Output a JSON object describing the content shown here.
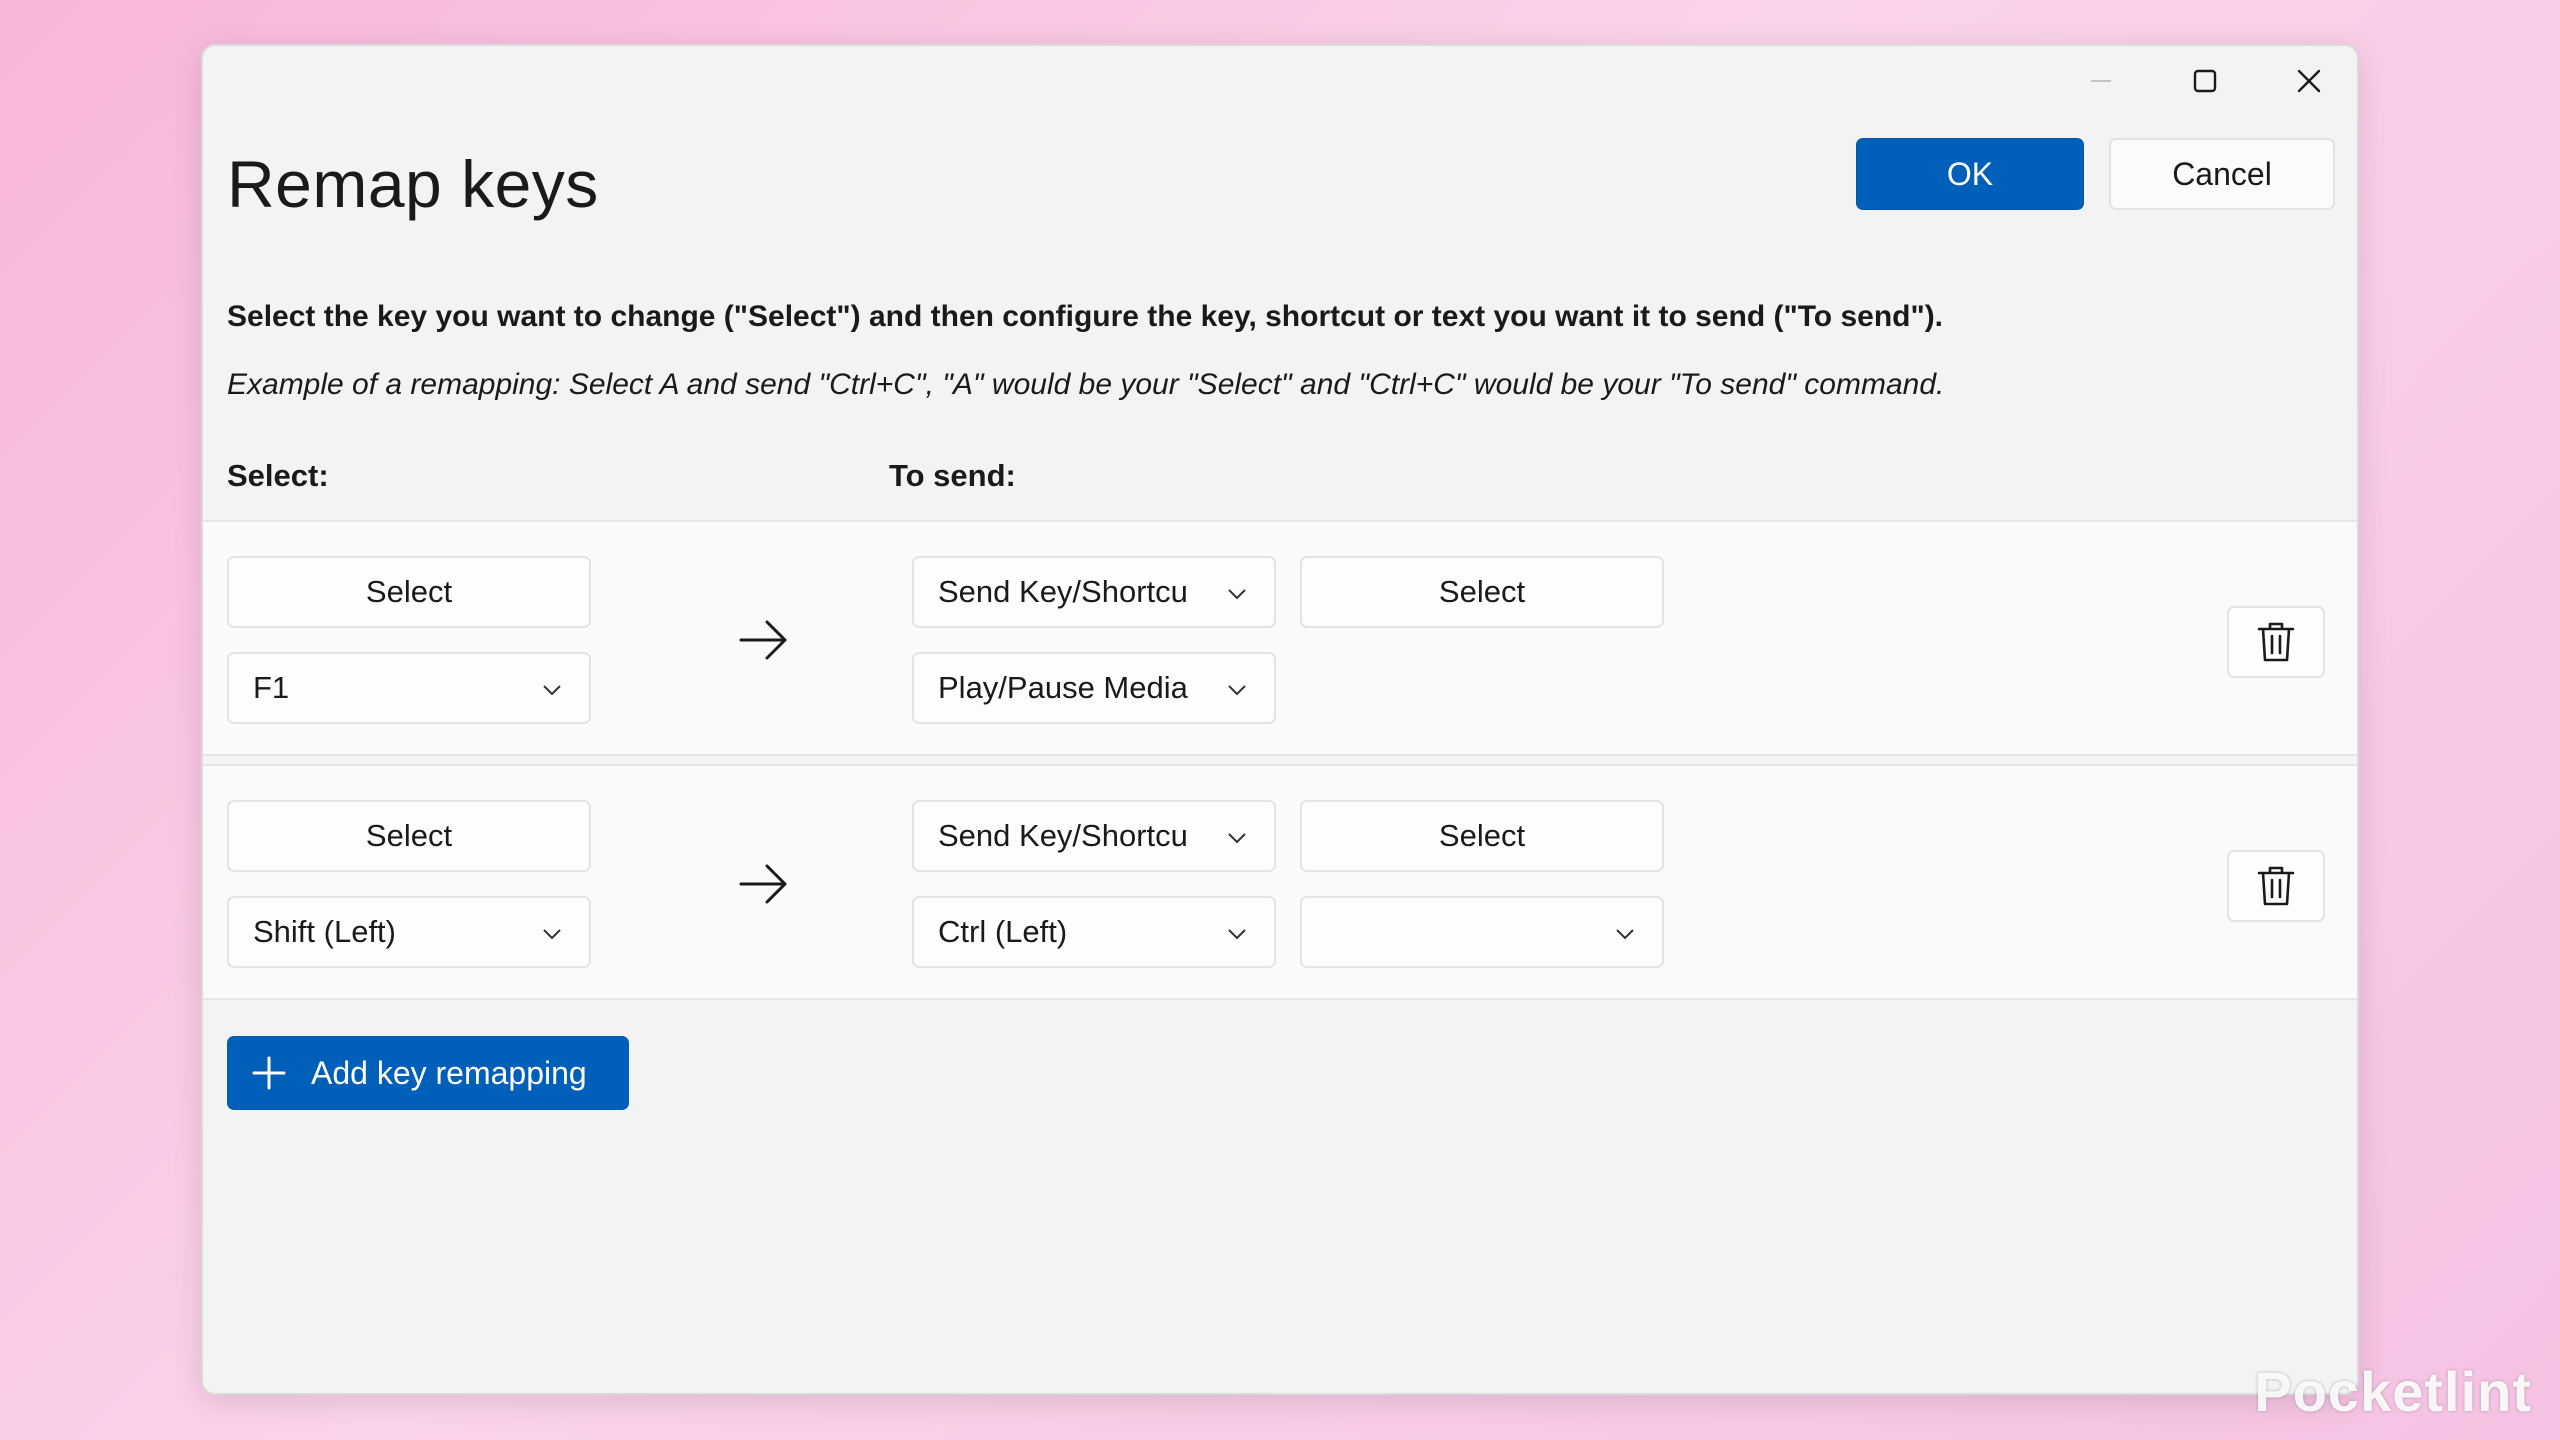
{
  "window": {
    "title": "Remap keys",
    "ok_label": "OK",
    "cancel_label": "Cancel"
  },
  "instructions": {
    "text": "Select the key you want to change (\"Select\") and then configure the key, shortcut or text you want it to send (\"To send\").",
    "example": "Example of a remapping: Select A and send \"Ctrl+C\", \"A\" would be your \"Select\" and \"Ctrl+C\" would be your \"To send\" command."
  },
  "columns": {
    "select": "Select:",
    "to_send": "To send:"
  },
  "rows": [
    {
      "select_button": "Select",
      "select_key": "F1",
      "send_type": "Send Key/Shortcu",
      "send_select_button": "Select",
      "send_key": "Play/Pause Media"
    },
    {
      "select_button": "Select",
      "select_key": "Shift (Left)",
      "send_type": "Send Key/Shortcu",
      "send_select_button": "Select",
      "send_key": "Ctrl (Left)",
      "send_key2": ""
    }
  ],
  "add_button": "Add key remapping",
  "watermark": "Pocketlint",
  "colors": {
    "accent": "#005fb8",
    "window_bg": "#f3f3f3",
    "row_bg": "#fafafa"
  },
  "icons": [
    "minimize-icon",
    "maximize-icon",
    "close-icon",
    "arrow-right-icon",
    "chevron-down-icon",
    "trash-icon",
    "plus-icon"
  ]
}
